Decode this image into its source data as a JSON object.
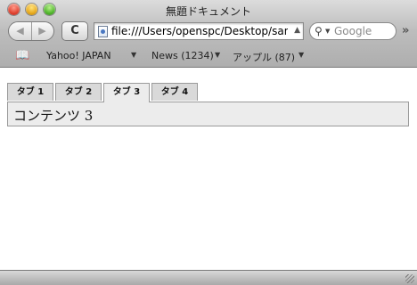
{
  "window": {
    "title": "無題ドキュメント"
  },
  "toolbar": {
    "back_glyph": "◀",
    "forward_glyph": "▶",
    "reload_glyph": "C",
    "url": "file:///Users/openspc/Desktop/san",
    "search_placeholder": "Google",
    "overflow_glyph": "»"
  },
  "bookmarks": {
    "items": [
      {
        "label": "Yahoo! JAPAN",
        "has_menu": true
      },
      {
        "label": "News (1234)",
        "has_menu": true
      },
      {
        "label": "アップル (87)",
        "has_menu": true
      }
    ]
  },
  "tabs": [
    {
      "label": "タブ 1",
      "selected": false
    },
    {
      "label": "タブ 2",
      "selected": false
    },
    {
      "label": "タブ 3",
      "selected": true
    },
    {
      "label": "タブ 4",
      "selected": false
    }
  ],
  "panel": {
    "text": "コンテンツ 3"
  },
  "icons": {
    "close": "red-close-icon",
    "minimize": "yellow-minimize-icon",
    "zoom": "green-zoom-icon",
    "search": "magnifier-icon",
    "bookmarks": "book-icon",
    "page": "document-icon"
  }
}
